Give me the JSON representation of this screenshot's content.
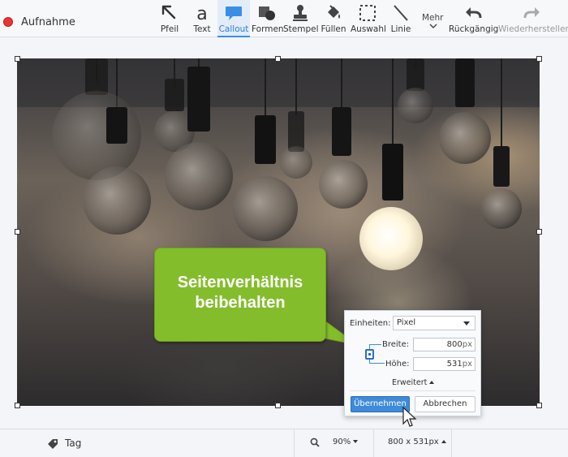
{
  "app": {
    "title": "Aufnahme"
  },
  "toolbar": {
    "tools": [
      {
        "label": "Pfeil",
        "icon": "arrow-icon"
      },
      {
        "label": "Text",
        "icon": "text-icon"
      },
      {
        "label": "Callout",
        "icon": "callout-icon",
        "active": true
      },
      {
        "label": "Formen",
        "icon": "shapes-icon"
      },
      {
        "label": "Stempel",
        "icon": "stamp-icon"
      },
      {
        "label": "Füllen",
        "icon": "fill-bucket-icon"
      },
      {
        "label": "Auswahl",
        "icon": "selection-icon"
      },
      {
        "label": "Linie",
        "icon": "line-icon"
      }
    ],
    "more_label": "Mehr",
    "undo_label": "Rückgängig",
    "redo_label": "Wiederherstellen"
  },
  "callout": {
    "line1": "Seitenverhältnis",
    "line2": "beibehalten",
    "color": "#84bd2c"
  },
  "resize_panel": {
    "units_label": "Einheiten:",
    "units_value": "Pixel",
    "width_label": "Breite:",
    "width_value": "800",
    "width_unit": "px",
    "height_label": "Höhe:",
    "height_value": "531",
    "height_unit": "px",
    "advanced_label": "Erweitert",
    "apply_label": "Übernehmen",
    "cancel_label": "Abbrechen",
    "accent": "#3f8ad8"
  },
  "statusbar": {
    "tag_label": "Tag",
    "zoom_value": "90%",
    "dimensions": "800 x 531px"
  }
}
